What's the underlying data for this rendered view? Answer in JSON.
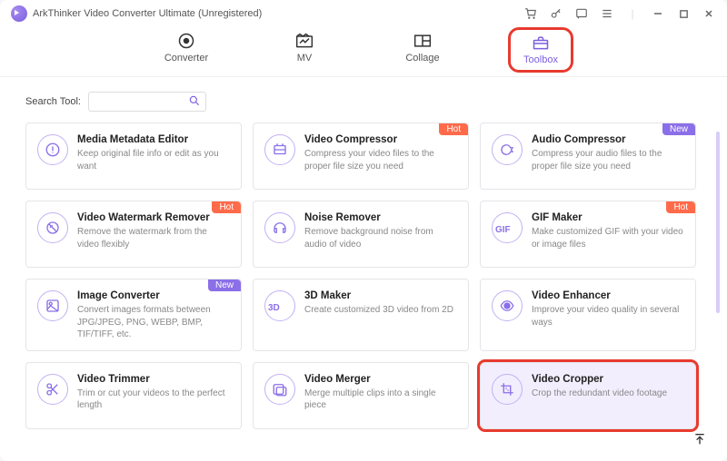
{
  "title": "ArkThinker Video Converter Ultimate (Unregistered)",
  "nav": {
    "converter": "Converter",
    "mv": "MV",
    "collage": "Collage",
    "toolbox": "Toolbox"
  },
  "search": {
    "label": "Search Tool:",
    "placeholder": ""
  },
  "badges": {
    "hot": "Hot",
    "new": "New"
  },
  "tools": [
    {
      "title": "Media Metadata Editor",
      "desc": "Keep original file info or edit as you want"
    },
    {
      "title": "Video Compressor",
      "desc": "Compress your video files to the proper file size you need",
      "badge": "hot"
    },
    {
      "title": "Audio Compressor",
      "desc": "Compress your audio files to the proper file size you need",
      "badge": "new"
    },
    {
      "title": "Video Watermark Remover",
      "desc": "Remove the watermark from the video flexibly",
      "badge": "hot"
    },
    {
      "title": "Noise Remover",
      "desc": "Remove background noise from audio of video"
    },
    {
      "title": "GIF Maker",
      "desc": "Make customized GIF with your video or image files",
      "badge": "hot"
    },
    {
      "title": "Image Converter",
      "desc": "Convert images formats between JPG/JPEG, PNG, WEBP, BMP, TIF/TIFF, etc.",
      "badge": "new"
    },
    {
      "title": "3D Maker",
      "desc": "Create customized 3D video from 2D"
    },
    {
      "title": "Video Enhancer",
      "desc": "Improve your video quality in several ways"
    },
    {
      "title": "Video Trimmer",
      "desc": "Trim or cut your videos to the perfect length"
    },
    {
      "title": "Video Merger",
      "desc": "Merge multiple clips into a single piece"
    },
    {
      "title": "Video Cropper",
      "desc": "Crop the redundant video footage",
      "selected": true
    }
  ]
}
